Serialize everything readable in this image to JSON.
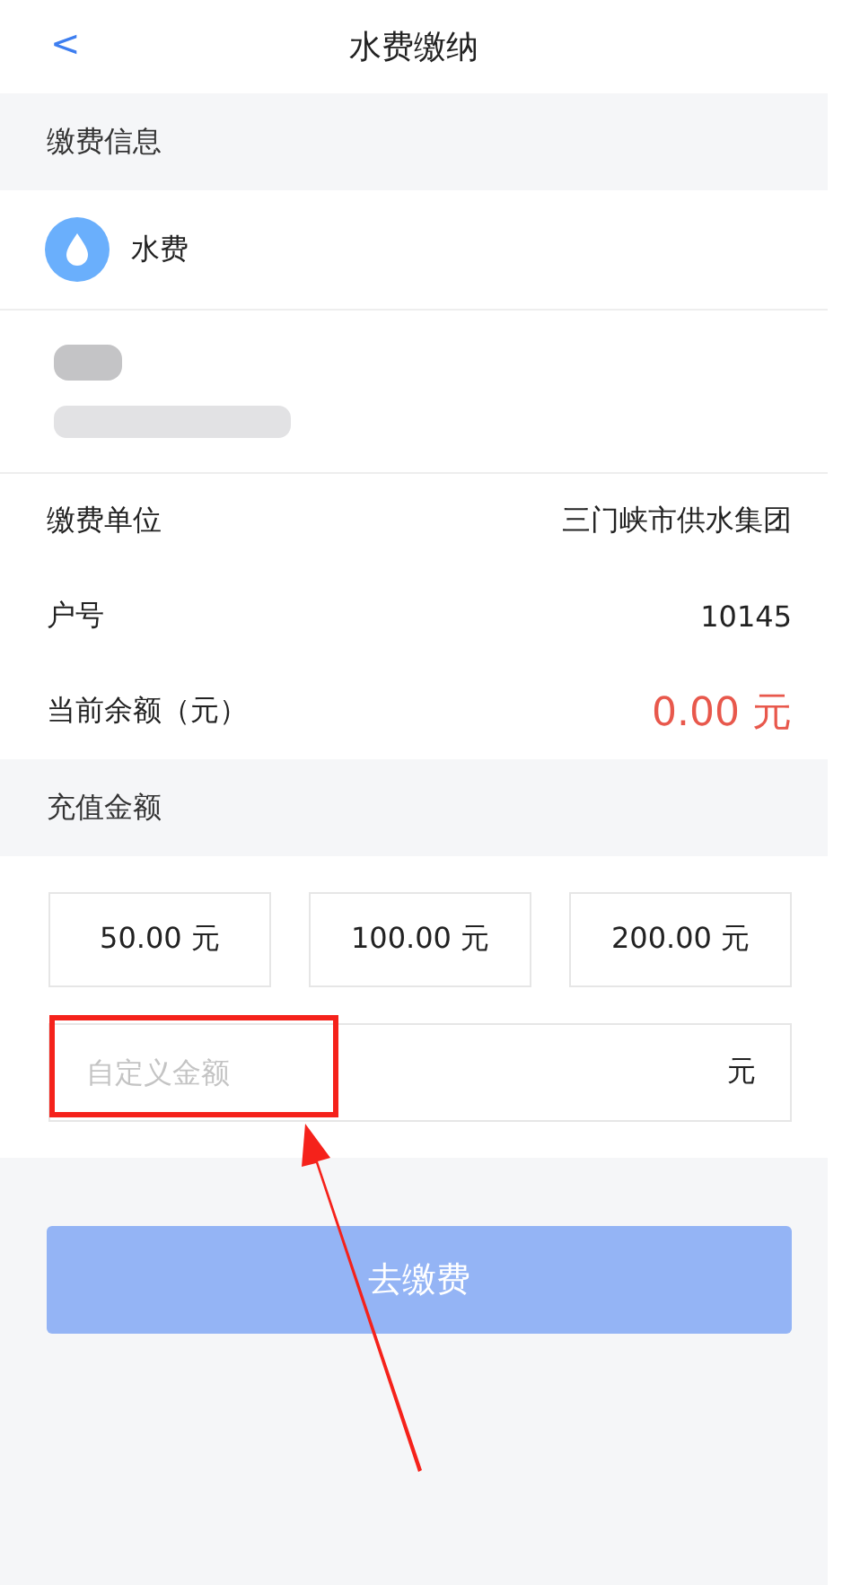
{
  "header": {
    "back": "<",
    "title": "水费缴纳"
  },
  "info_section": {
    "title": "缴费信息"
  },
  "bill_type": {
    "label": "水费"
  },
  "details": [
    {
      "label": "缴费单位",
      "value": "三门峡市供水集团",
      "kind": "plain"
    },
    {
      "label": "户号",
      "value": "10145",
      "kind": "plain"
    },
    {
      "label": "当前余额（元）",
      "value": "0.00 元",
      "kind": "highlight"
    }
  ],
  "recharge_section": {
    "title": "充值金额"
  },
  "amounts": [
    "50.00 元",
    "100.00 元",
    "200.00 元"
  ],
  "custom_amount": {
    "placeholder": "自定义金额",
    "unit": "元"
  },
  "pay_button": {
    "label": "去缴费",
    "disabled": true
  }
}
